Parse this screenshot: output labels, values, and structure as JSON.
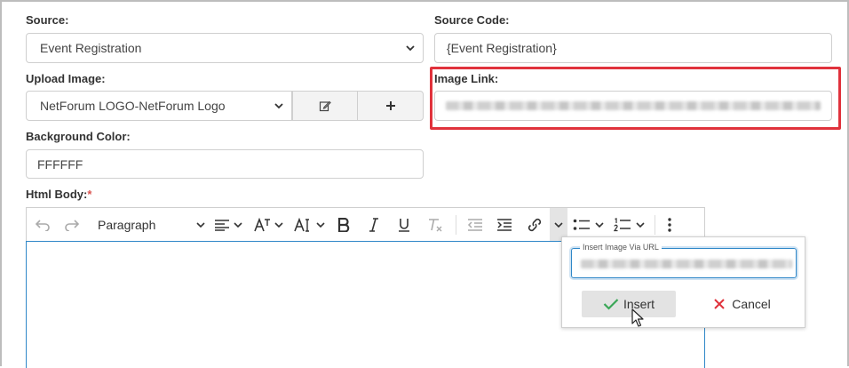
{
  "form": {
    "source": {
      "label": "Source:",
      "value": "Event Registration"
    },
    "source_code": {
      "label": "Source Code:",
      "value": "{Event Registration}"
    },
    "upload_image": {
      "label": "Upload Image:",
      "value": "NetForum LOGO-NetForum Logo"
    },
    "image_link": {
      "label": "Image Link:"
    },
    "background_color": {
      "label": "Background Color:",
      "value": "FFFFFF"
    },
    "html_body": {
      "label": "Html Body:",
      "required_mark": "*"
    }
  },
  "toolbar": {
    "paragraph_label": "Paragraph"
  },
  "insert_popup": {
    "field_label": "Insert Image Via URL",
    "insert_label": "Insert",
    "cancel_label": "Cancel"
  },
  "colors": {
    "highlight": "#e0323c",
    "focus_blue": "#2f87c8",
    "insert_check": "#3aa757",
    "cancel_x": "#e0323c",
    "required": "#d9534f"
  }
}
